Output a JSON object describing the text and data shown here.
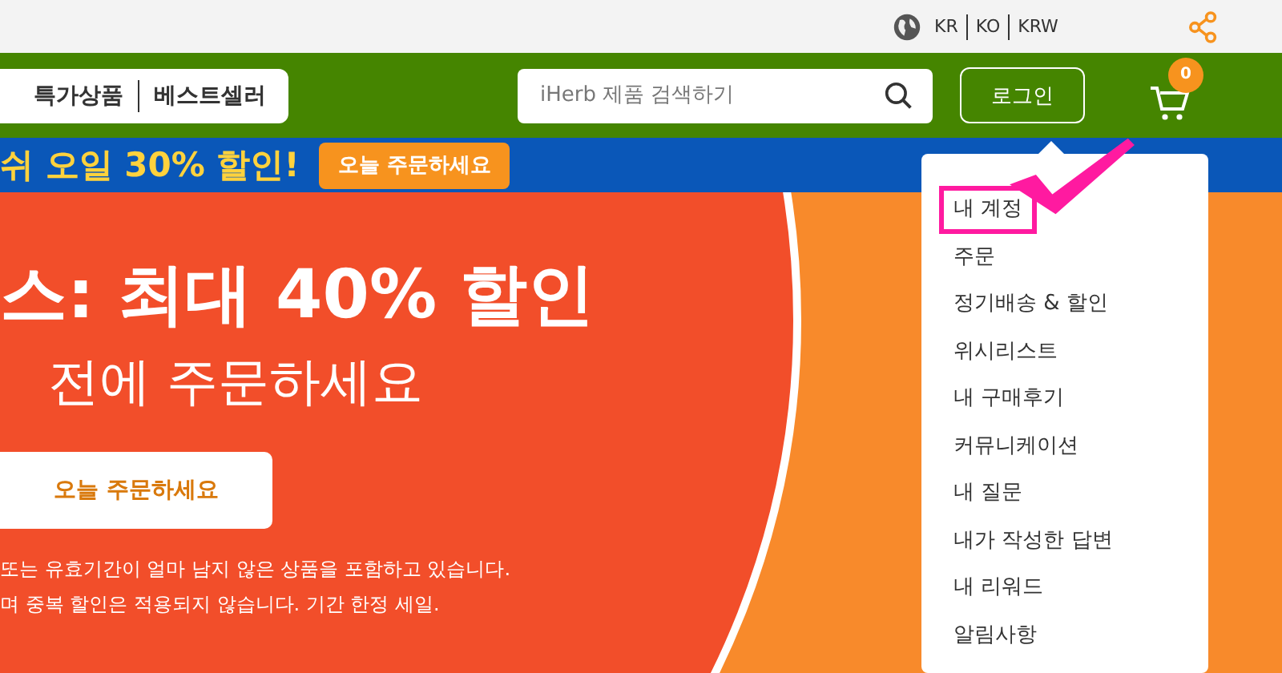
{
  "top_bar": {
    "locale": [
      "KR",
      "KO",
      "KRW"
    ]
  },
  "nav": {
    "links": [
      "특가상품",
      "베스트셀러"
    ],
    "search": {
      "placeholder": "iHerb 제품 검색하기"
    },
    "login": "로그인",
    "cart_count": "0"
  },
  "promo_bar": {
    "text": "쉬 오일 30% 할인!",
    "button": "오늘 주문하세요"
  },
  "banner": {
    "headline": "스: 최대 40% 할인",
    "subline": "전에 주문하세요",
    "button": "오늘 주문하세요",
    "notes": [
      "또는 유효기간이 얼마 남지 않은 상품을 포함하고 있습니다.",
      "며 중복 할인은 적용되지 않습니다. 기간 한정 세일."
    ]
  },
  "account_menu": {
    "items": [
      {
        "label": "내 계정",
        "highlighted": true
      },
      {
        "label": "주문",
        "highlighted": false
      },
      {
        "label": "정기배송 & 할인",
        "highlighted": false
      },
      {
        "label": "위시리스트",
        "highlighted": false
      },
      {
        "label": "내 구매후기",
        "highlighted": false
      },
      {
        "label": "커뮤니케이션",
        "highlighted": false
      },
      {
        "label": "내 질문",
        "highlighted": false
      },
      {
        "label": "내가 작성한 답변",
        "highlighted": false
      },
      {
        "label": "내 리워드",
        "highlighted": false
      },
      {
        "label": "알림사항",
        "highlighted": false
      }
    ]
  }
}
